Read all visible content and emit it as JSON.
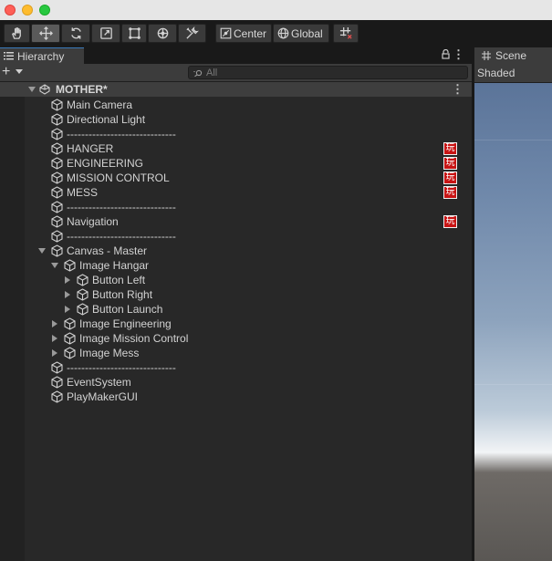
{
  "toolbar": {
    "pivot_mode": "Center",
    "pivot_rotation": "Global"
  },
  "hierarchy": {
    "tab_label": "Hierarchy",
    "search_placeholder": "All",
    "scene_name": "MOTHER*",
    "rows": [
      {
        "label": "Main Camera",
        "depth": 0,
        "expander": "none",
        "badge": false
      },
      {
        "label": "Directional Light",
        "depth": 0,
        "expander": "none",
        "badge": false
      },
      {
        "label": "------------------------------",
        "depth": 0,
        "expander": "none",
        "badge": false
      },
      {
        "label": "HANGER",
        "depth": 0,
        "expander": "none",
        "badge": true
      },
      {
        "label": "ENGINEERING",
        "depth": 0,
        "expander": "none",
        "badge": true
      },
      {
        "label": "MISSION CONTROL",
        "depth": 0,
        "expander": "none",
        "badge": true
      },
      {
        "label": "MESS",
        "depth": 0,
        "expander": "none",
        "badge": true
      },
      {
        "label": "------------------------------",
        "depth": 0,
        "expander": "none",
        "badge": false
      },
      {
        "label": "Navigation",
        "depth": 0,
        "expander": "none",
        "badge": true
      },
      {
        "label": "------------------------------",
        "depth": 0,
        "expander": "none",
        "badge": false
      },
      {
        "label": "Canvas - Master",
        "depth": 0,
        "expander": "open",
        "badge": false
      },
      {
        "label": "Image Hangar",
        "depth": 1,
        "expander": "open",
        "badge": false
      },
      {
        "label": "Button Left",
        "depth": 2,
        "expander": "closed",
        "badge": false
      },
      {
        "label": "Button Right",
        "depth": 2,
        "expander": "closed",
        "badge": false
      },
      {
        "label": "Button Launch",
        "depth": 2,
        "expander": "closed",
        "badge": false
      },
      {
        "label": "Image Engineering",
        "depth": 1,
        "expander": "closed",
        "badge": false
      },
      {
        "label": "Image Mission Control",
        "depth": 1,
        "expander": "closed",
        "badge": false
      },
      {
        "label": "Image Mess",
        "depth": 1,
        "expander": "closed",
        "badge": false
      },
      {
        "label": "------------------------------",
        "depth": 0,
        "expander": "none",
        "badge": false
      },
      {
        "label": "EventSystem",
        "depth": 0,
        "expander": "none",
        "badge": false
      },
      {
        "label": "PlayMakerGUI",
        "depth": 0,
        "expander": "none",
        "badge": false
      }
    ],
    "badge_glyph": "玩",
    "badge_color": "#c81414"
  },
  "scene": {
    "tab_label": "Scene",
    "shading_mode": "Shaded"
  }
}
